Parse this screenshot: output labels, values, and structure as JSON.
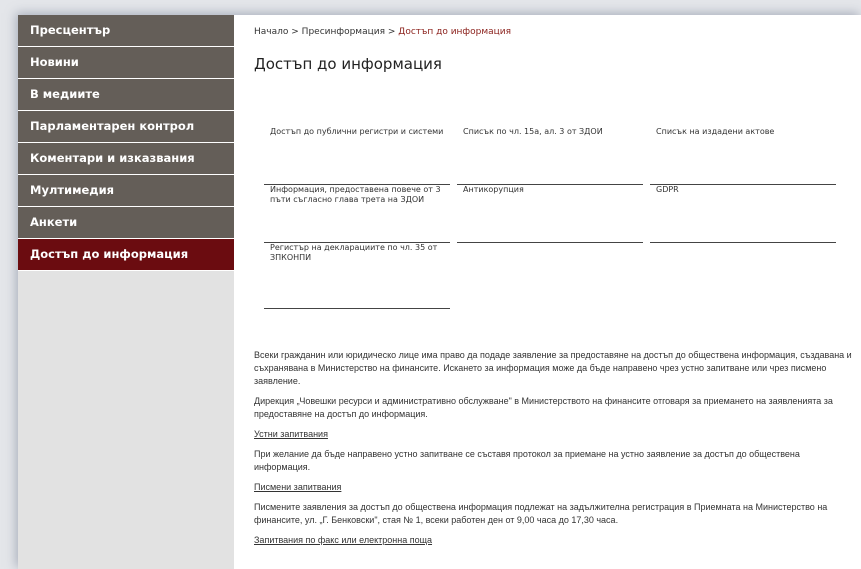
{
  "sidebar": {
    "items": [
      {
        "label": "Пресцентър"
      },
      {
        "label": "Новини"
      },
      {
        "label": "В медиите"
      },
      {
        "label": "Парламентарен контрол"
      },
      {
        "label": "Коментари и изказвания"
      },
      {
        "label": "Мултимедия"
      },
      {
        "label": "Анкети"
      },
      {
        "label": "Достъп до информация"
      }
    ]
  },
  "breadcrumb": {
    "home": "Начало",
    "section": "Пресинформация",
    "current": "Достъп до информация",
    "separator": ">"
  },
  "page_title": "Достъп до информация",
  "links": [
    {
      "label": "Достъп до публични регистри и системи"
    },
    {
      "label": "Списък по чл. 15а, ал. 3 от ЗДОИ"
    },
    {
      "label": "Списък на издадени актове"
    },
    {
      "label": "Информация, предоставена повече от 3 пъти съгласно глава трета на ЗДОИ"
    },
    {
      "label": "Антикорупция"
    },
    {
      "label": "GDPR"
    },
    {
      "label": "Регистър на декларациите по чл. 35 от ЗПКОНПИ"
    }
  ],
  "body": {
    "p1": "Всеки гражданин или юридическо лице има право да подаде заявление за предоставяне на достъп до обществена информация, създавана и съхранявана в Министерство на финансите. Искането за информация може да бъде направено чрез устно запитване или чрез писмено заявление.",
    "p2": "Дирекция „Човешки ресурси и административно обслужване\" в Министерството на финансите отговаря за приемането на заявленията за предоставяне на достъп до информация.",
    "link_oral": "Устни запитвания",
    "p3": "При желание да бъде направено устно запитване се съставя протокол за приемане на устно заявление за достъп до обществена информация.",
    "link_written": "Писмени запитвания",
    "p4": "Писмените заявления за достъп до обществена информация подлежат на задължителна регистрация в Приемната на Министерство на финансите, ул. „Г. Бенковски\", стая № 1, всеки работен ден от 9,00 часа до 17,30 часа.",
    "link_fax": "Запитвания по факс или електронна поща"
  },
  "colors": {
    "sidebar_item": "#645e58",
    "sidebar_active": "#6b0c10",
    "breadcrumb_current": "#8a1f1a"
  }
}
